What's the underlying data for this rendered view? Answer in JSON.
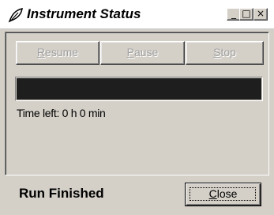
{
  "window": {
    "title": "Instrument Status",
    "icon": "feather-icon",
    "controls": {
      "minimize": "_",
      "maximize": "□",
      "close": "×"
    }
  },
  "buttons": {
    "resume": {
      "accel": "R",
      "rest": "esume",
      "enabled": false
    },
    "pause": {
      "accel": "P",
      "rest": "ause",
      "enabled": false
    },
    "stop": {
      "accel": "S",
      "rest": "top",
      "enabled": false
    }
  },
  "progress": {
    "value_percent": 100
  },
  "time_left": "Time left: 0 h  0 min",
  "status": "Run Finished",
  "close_button": {
    "accel": "C",
    "rest": "lose"
  },
  "colors": {
    "face": "#d4d0c8",
    "progress_fill": "#1e1e1e",
    "disabled_text": "#a0a0a0"
  }
}
